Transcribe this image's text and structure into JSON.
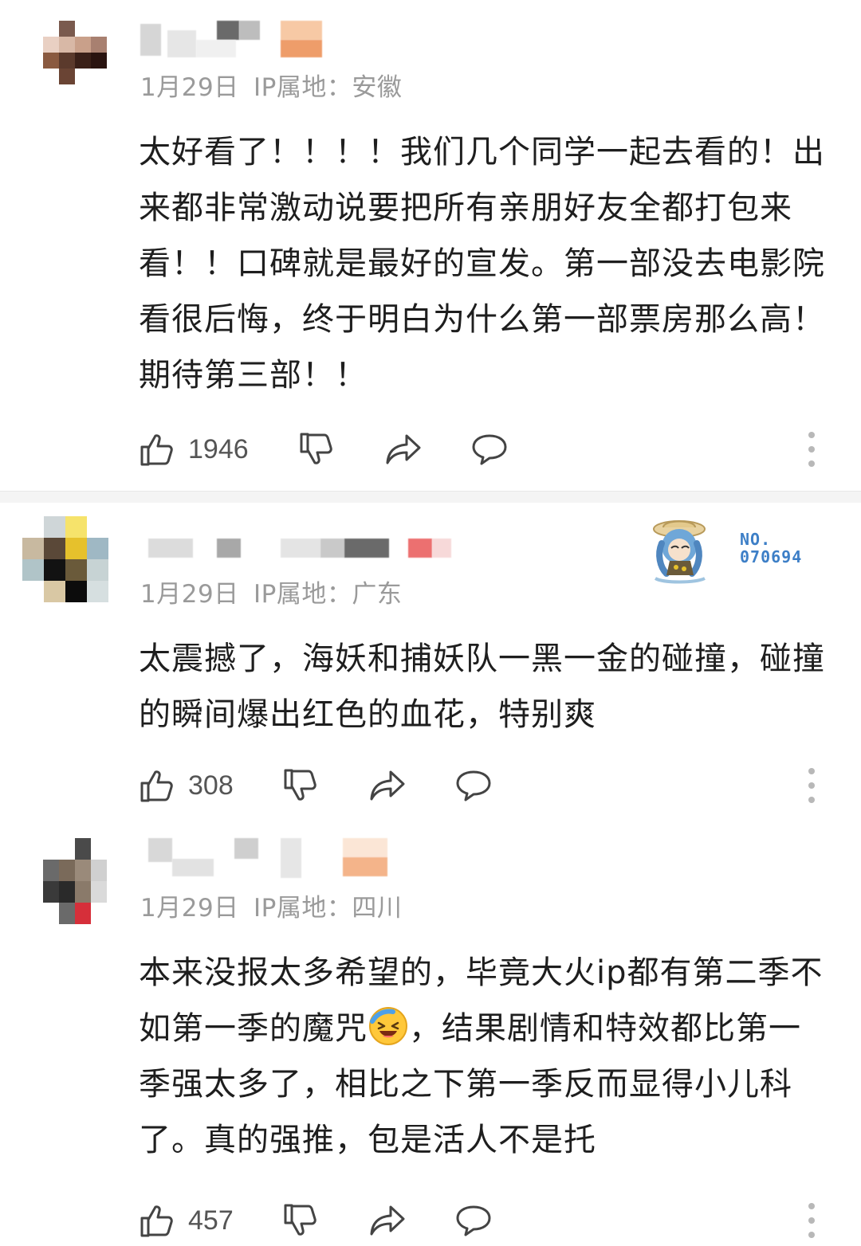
{
  "comments": [
    {
      "date": "1月29日",
      "ip_label": "IP属地：",
      "ip_location": "安徽",
      "text": "太好看了！！！！我们几个同学一起去看的！出来都非常激动说要把所有亲朋好友全都打包来看！！口碑就是最好的宣发。第一部没去电影院看很后悔，终于明白为什么第一部票房那么高！期待第三部！！",
      "likes": "1946"
    },
    {
      "date": "1月29日",
      "ip_label": "IP属地：",
      "ip_location": "广东",
      "badge": {
        "line1": "NO.",
        "line2": "070694"
      },
      "text": "太震撼了，海妖和捕妖队一黑一金的碰撞，碰撞的瞬间爆出红色的血花，特别爽",
      "likes": "308"
    },
    {
      "date": "1月29日",
      "ip_label": "IP属地：",
      "ip_location": "四川",
      "text_before_emoji": "本来没报太多希望的，毕竟大火ip都有第二季不如第一季的魔咒",
      "emoji": "laughing-crying-emoji",
      "text_after_emoji": "，结果剧情和特效都比第一季强太多了，相比之下第一季反而显得小儿科了。真的强推，包是活人不是托",
      "likes": "457"
    }
  ],
  "icons": {
    "like": "thumbs-up-icon",
    "dislike": "thumbs-down-icon",
    "share": "share-icon",
    "reply": "reply-bubble-icon",
    "more": "more-vertical-icon"
  },
  "colors": {
    "meta_text": "#9a9a9a",
    "body_text": "#1e1e1e",
    "badge_blue": "#3d7fc7"
  }
}
